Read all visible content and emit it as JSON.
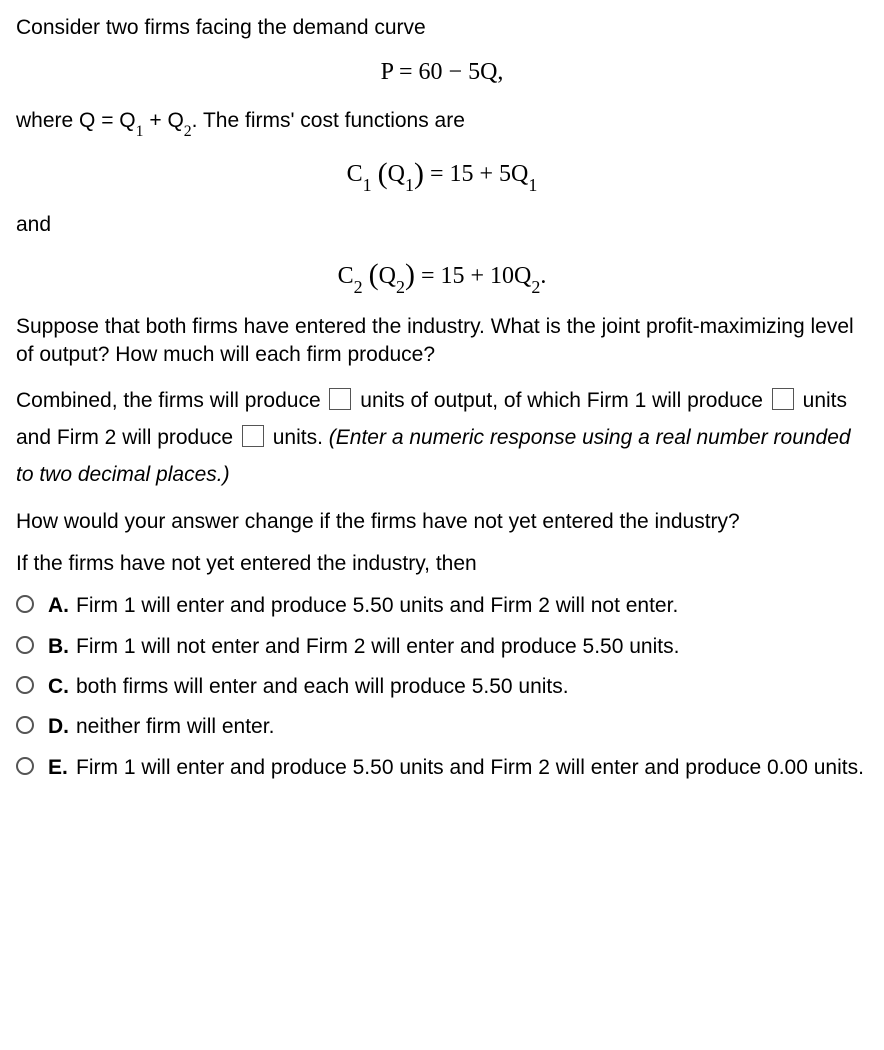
{
  "p1": "Consider two firms facing the demand curve",
  "eq1": "P = 60 − 5Q,",
  "p2a": "where Q = Q",
  "p2b": " + Q",
  "p2c": ".  The firms' cost functions are",
  "eq2_lhs_a": "C",
  "eq2_lhs_b": " ",
  "eq2_paren_open": "(",
  "eq2_inner": "Q",
  "eq2_paren_close": ")",
  "eq2_rhs": " = 15 + 5Q",
  "and": "and",
  "eq3_lhs_a": "C",
  "eq3_inner": "Q",
  "eq3_rhs": " = 15 + 10Q",
  "eq3_period": ".",
  "p3": "Suppose that both firms have entered the industry.  What is the joint profit-maximizing level of output?  How much will each firm produce?",
  "fill_a1": "Combined, the firms will produce ",
  "fill_a2": " units of output, of which Firm 1 will produce ",
  "fill_a3": " units and Firm 2 will produce ",
  "fill_a4": " units. ",
  "fill_hint": "(Enter a numeric response using a real number rounded to two decimal places.)",
  "p4": "How would your answer change if the firms have not yet entered the industry?",
  "p5": "If the firms have not yet entered the industry, then",
  "choices": [
    {
      "letter": "A.",
      "text": "Firm 1 will enter and produce 5.50 units and Firm 2 will not enter."
    },
    {
      "letter": "B.",
      "text": "Firm 1 will not enter and Firm 2 will enter and produce 5.50 units."
    },
    {
      "letter": "C.",
      "text": "both firms will enter and each will produce 5.50 units."
    },
    {
      "letter": "D.",
      "text": "neither firm will enter."
    },
    {
      "letter": "E.",
      "text": "Firm 1 will enter and produce 5.50 units and Firm 2 will enter and produce 0.00 units."
    }
  ]
}
